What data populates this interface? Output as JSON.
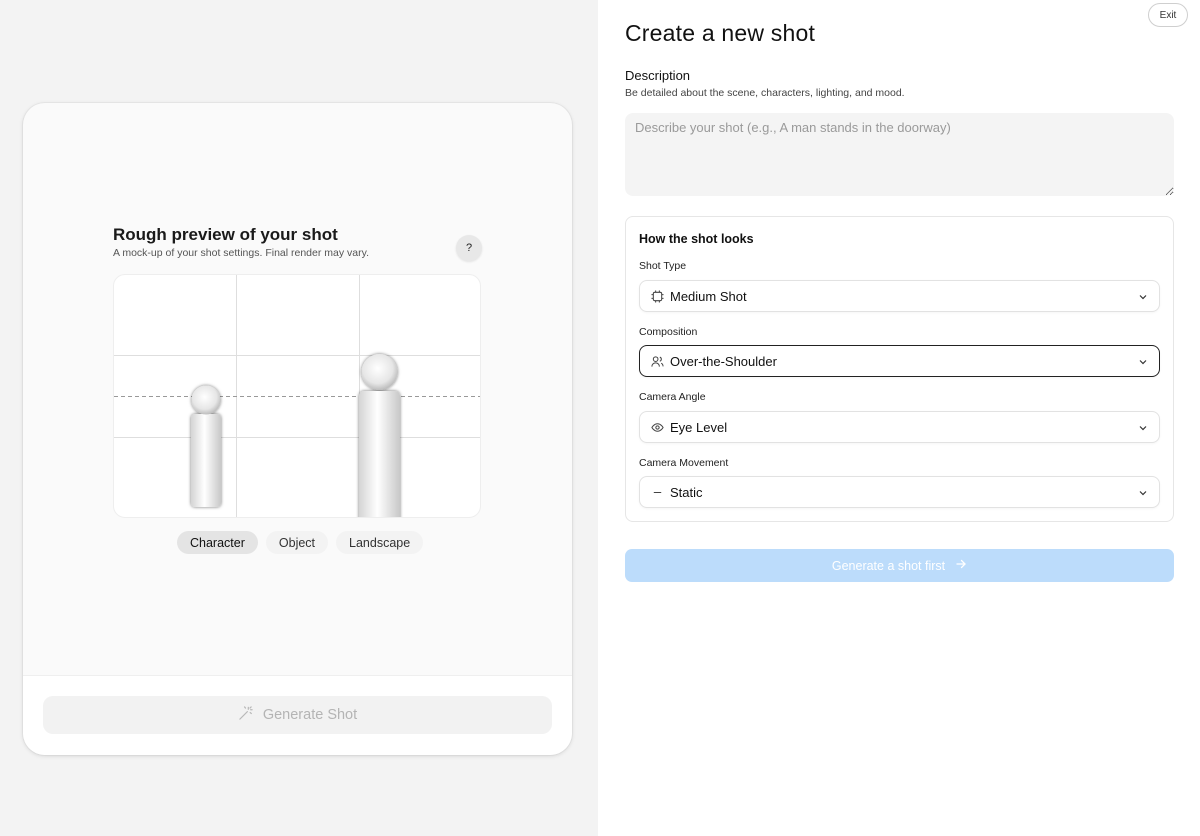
{
  "preview": {
    "title": "Rough preview of your shot",
    "subtitle": "A mock-up of your shot settings. Final render may vary.",
    "help_label": "?",
    "mode_tabs": [
      {
        "label": "Character",
        "active": true
      },
      {
        "label": "Object",
        "active": false
      },
      {
        "label": "Landscape",
        "active": false
      }
    ],
    "generate_label": "Generate Shot"
  },
  "panel": {
    "exit_label": "Exit",
    "title": "Create a new shot",
    "description": {
      "label": "Description",
      "hint": "Be detailed about the scene, characters, lighting, and mood.",
      "placeholder": "Describe your shot (e.g., A man stands in the doorway)",
      "value": ""
    },
    "looks": {
      "title": "How the shot looks",
      "fields": [
        {
          "label": "Shot Type",
          "value": "Medium Shot",
          "icon": "frame-icon"
        },
        {
          "label": "Composition",
          "value": "Over-the-Shoulder",
          "icon": "people-icon"
        },
        {
          "label": "Camera Angle",
          "value": "Eye Level",
          "icon": "eye-icon"
        },
        {
          "label": "Camera Movement",
          "value": "Static",
          "icon": "dash-icon"
        }
      ]
    },
    "generate_first_label": "Generate a shot first"
  },
  "colors": {
    "accent_disabled": "#bcdcfb",
    "panel_bg": "#ffffff",
    "app_bg": "#f3f3f3"
  }
}
